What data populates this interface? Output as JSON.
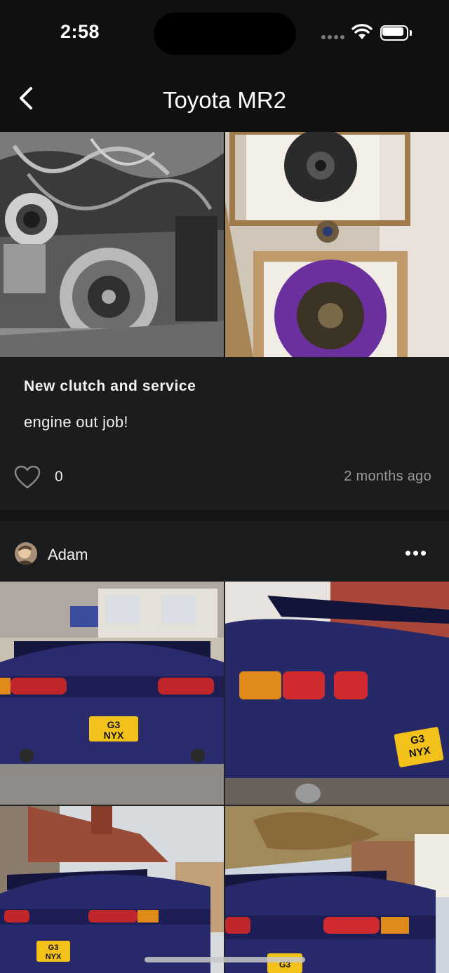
{
  "status_bar": {
    "time": "2:58"
  },
  "nav": {
    "title": "Toyota MR2",
    "back_icon": "chevron-left-icon"
  },
  "post1": {
    "title": "New clutch and service",
    "body": "engine out job!",
    "likes": "0",
    "time_ago": "2 months ago",
    "like_icon": "heart-outline-icon"
  },
  "post2": {
    "author": "Adam",
    "more_icon": "ellipsis-icon",
    "plate_text_line1": "G3",
    "plate_text_line2": "NYX"
  },
  "colors": {
    "background": "#111213",
    "card": "#1b1c1e",
    "car_paint": "#2a2a6e",
    "clutch_purple": "#6b2f9e",
    "plate_yellow": "#f2c21b"
  }
}
